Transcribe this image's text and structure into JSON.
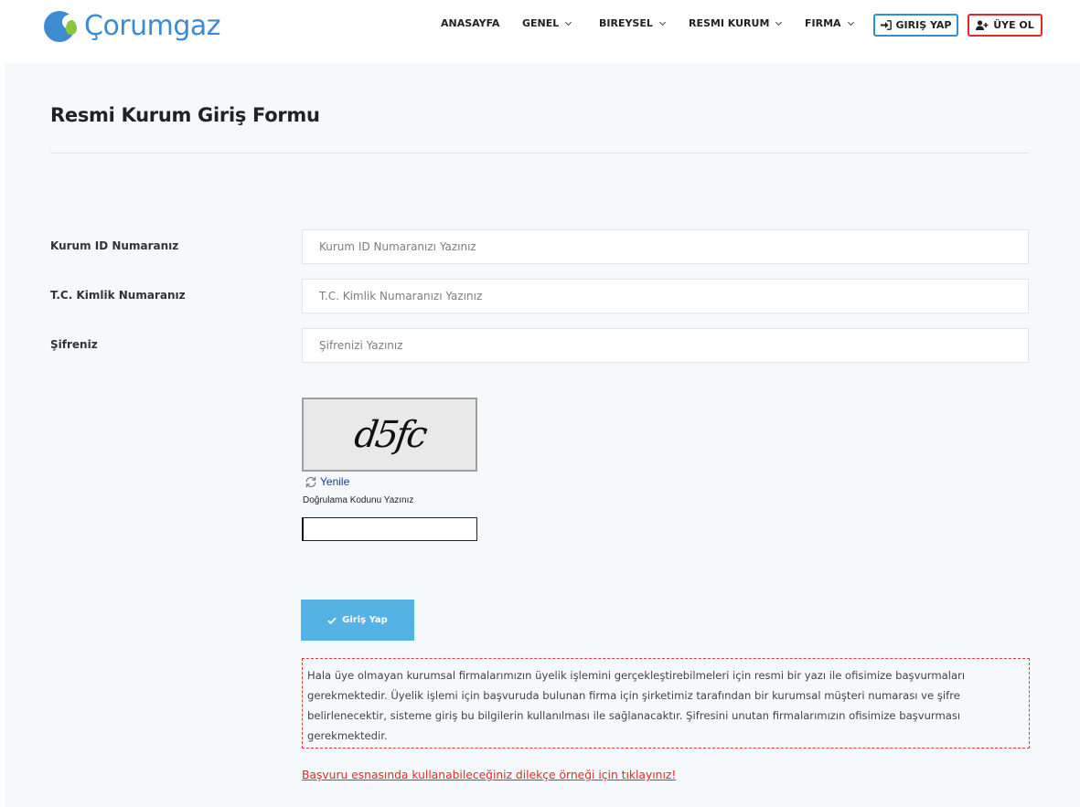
{
  "brand": {
    "name": "Çorumgaz"
  },
  "nav": {
    "home": "ANASAYFA",
    "general": "GENEL",
    "individual": "BIREYSEL",
    "institution": "RESMI KURUM",
    "company": "FIRMA",
    "login": "GIRIŞ YAP",
    "register": "ÜYE OL"
  },
  "page": {
    "title": "Resmi Kurum Giriş Formu"
  },
  "form": {
    "institution_id": {
      "label": "Kurum ID Numaranız",
      "placeholder": "Kurum ID Numaranızı Yazınız",
      "value": ""
    },
    "tc_id": {
      "label": "T.C. Kimlik Numaranız",
      "placeholder": "T.C. Kimlik Numaranızı Yazınız",
      "value": ""
    },
    "password": {
      "label": "Şifreniz",
      "placeholder": "Şifrenizi Yazınız",
      "value": ""
    }
  },
  "captcha": {
    "code": "d5fc",
    "refresh_label": "Yenile",
    "verify_label": "Doğrulama Kodunu Yazınız",
    "value": ""
  },
  "submit_label": "Giriş Yap",
  "notice_text": "Hala üye olmayan kurumsal firmalarımızın üyelik işlemini gerçekleştirebilmeleri için resmi bir yazı ile ofisimize başvurmaları gerekmektedir. Üyelik işlemi için başvuruda bulunan firma için şirketimiz tarafından bir kurumsal müşteri numarası ve şifre belirlenecektir, sisteme giriş bu bilgilerin kullanılması ile sağlanacaktır. Şifresini unutan firmalarımızın ofisimize başvurması gerekmektedir.",
  "petition_link": "Başvuru esnasında kullanabileceğiniz dilekçe örneği için tıklayınız!",
  "colors": {
    "brand_blue": "#3d8bd1",
    "brand_green": "#8cc63f",
    "login_border": "#2f8fd8",
    "register_border": "#e02a2a",
    "submit_bg": "#55b2e4",
    "notice_border": "#e03a3a",
    "panel_bg": "#f5f9fc"
  },
  "icons": {
    "login": "sign-in-icon",
    "register": "user-plus-icon",
    "refresh": "refresh-icon",
    "submit": "check-icon",
    "dropdown": "chevron-down-icon"
  }
}
